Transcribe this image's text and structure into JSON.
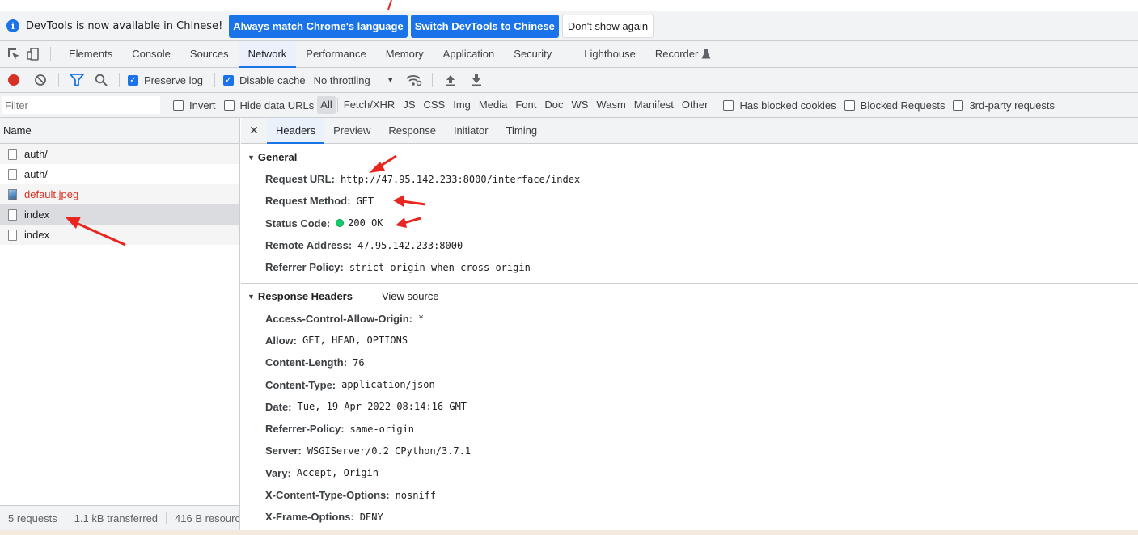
{
  "infobar": {
    "message": "DevTools is now available in Chinese!",
    "btn_match": "Always match Chrome's language",
    "btn_switch": "Switch DevTools to Chinese",
    "btn_dismiss": "Don't show again"
  },
  "tabs": [
    "Elements",
    "Console",
    "Sources",
    "Network",
    "Performance",
    "Memory",
    "Application",
    "Security",
    "Lighthouse",
    "Recorder"
  ],
  "toolbar": {
    "preserve_log": "Preserve log",
    "disable_cache": "Disable cache",
    "throttling": "No throttling"
  },
  "filterbar": {
    "placeholder": "Filter",
    "invert": "Invert",
    "hide_data_urls": "Hide data URLs",
    "types": [
      "All",
      "Fetch/XHR",
      "JS",
      "CSS",
      "Img",
      "Media",
      "Font",
      "Doc",
      "WS",
      "Wasm",
      "Manifest",
      "Other"
    ],
    "blocked_cookies": "Has blocked cookies",
    "blocked_requests": "Blocked Requests",
    "third_party": "3rd-party requests"
  },
  "requests": {
    "header": "Name",
    "items": [
      {
        "name": "auth/"
      },
      {
        "name": "auth/"
      },
      {
        "name": "default.jpeg"
      },
      {
        "name": "index"
      },
      {
        "name": "index"
      }
    ]
  },
  "status": {
    "requests": "5 requests",
    "transferred": "1.1 kB transferred",
    "resources": "416 B resources"
  },
  "detail_tabs": [
    "Headers",
    "Preview",
    "Response",
    "Initiator",
    "Timing"
  ],
  "general": {
    "title": "General",
    "rows": [
      {
        "key": "Request URL:",
        "value": "http://47.95.142.233:8000/interface/index"
      },
      {
        "key": "Request Method:",
        "value": "GET"
      },
      {
        "key": "Status Code:",
        "value": "200 OK"
      },
      {
        "key": "Remote Address:",
        "value": "47.95.142.233:8000"
      },
      {
        "key": "Referrer Policy:",
        "value": "strict-origin-when-cross-origin"
      }
    ]
  },
  "response_headers": {
    "title": "Response Headers",
    "view_source": "View source",
    "rows": [
      {
        "key": "Access-Control-Allow-Origin:",
        "value": "*"
      },
      {
        "key": "Allow:",
        "value": "GET, HEAD, OPTIONS"
      },
      {
        "key": "Content-Length:",
        "value": "76"
      },
      {
        "key": "Content-Type:",
        "value": "application/json"
      },
      {
        "key": "Date:",
        "value": "Tue, 19 Apr 2022 08:14:16 GMT"
      },
      {
        "key": "Referrer-Policy:",
        "value": "same-origin"
      },
      {
        "key": "Server:",
        "value": "WSGIServer/0.2 CPython/3.7.1"
      },
      {
        "key": "Vary:",
        "value": "Accept, Origin"
      },
      {
        "key": "X-Content-Type-Options:",
        "value": "nosniff"
      },
      {
        "key": "X-Frame-Options:",
        "value": "DENY"
      }
    ]
  },
  "colors": {
    "accent": "#1a73e8",
    "record": "#d93025",
    "status_ok": "#0cce6b",
    "annotation_arrow": "#e8251f"
  }
}
